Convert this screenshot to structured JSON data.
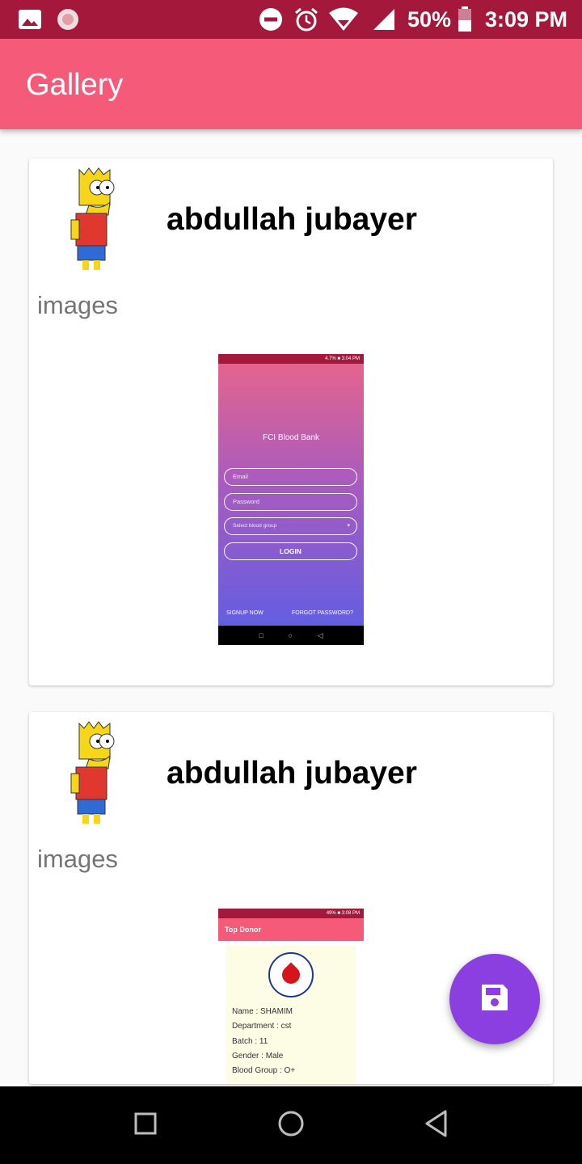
{
  "status_bar": {
    "battery": "50%",
    "time": "3:09 PM",
    "icons": [
      "image-icon",
      "app-icon",
      "dnd-icon",
      "alarm-icon",
      "wifi-icon",
      "signal-icon",
      "battery-icon"
    ]
  },
  "app_bar": {
    "title": "Gallery"
  },
  "posts": [
    {
      "author": "abdullah jubayer",
      "label": "images",
      "preview": {
        "status": "4.7% ■ 3:04 PM",
        "title": "FCI Blood Bank",
        "email_placeholder": "Email",
        "password_placeholder": "Password",
        "blood_group_placeholder": "Select blood group",
        "login": "LOGIN",
        "signup": "SIGNUP NOW",
        "forgot": "FORGOT PASSWORD?"
      }
    },
    {
      "author": "abdullah jubayer",
      "label": "images",
      "preview": {
        "status": "49% ■ 3:08 PM",
        "bar_title": "Top Donor",
        "name": "Name : SHAMIM",
        "department": "Department : cst",
        "batch": "Batch : 11",
        "gender": "Gender : Male",
        "blood_group": "Blood Group : O+"
      }
    }
  ],
  "fab": {
    "icon": "save-icon"
  },
  "nav": {
    "icons": [
      "recents-icon",
      "home-icon",
      "back-icon"
    ]
  },
  "colors": {
    "status_bar": "#a4193b",
    "app_bar": "#f55a78",
    "fab": "#8b3fe0"
  }
}
